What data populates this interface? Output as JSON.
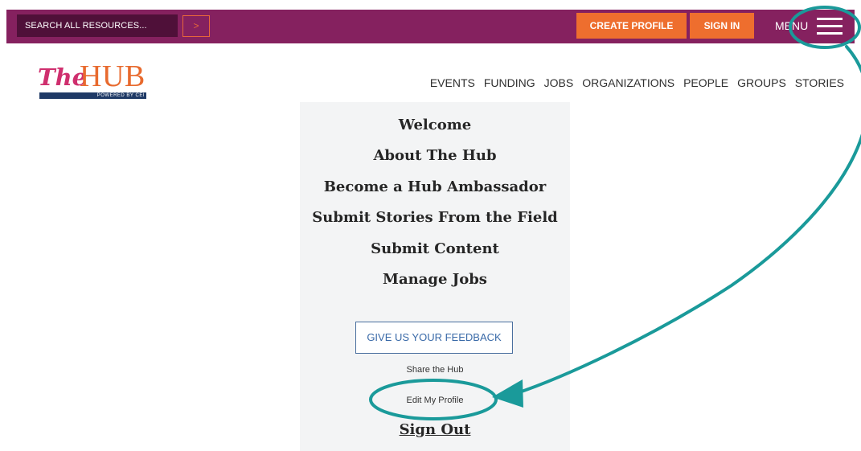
{
  "header": {
    "search_placeholder": "SEARCH ALL RESOURCES...",
    "search_button_glyph": ">",
    "create_profile": "CREATE PROFILE",
    "sign_in": "SIGN IN",
    "menu_label": "MENU"
  },
  "logo": {
    "the": "The",
    "hub": "HUB",
    "tagline": "POWERED BY CEI"
  },
  "nav": [
    "EVENTS",
    "FUNDING",
    "JOBS",
    "ORGANIZATIONS",
    "PEOPLE",
    "GROUPS",
    "STORIES"
  ],
  "dropdown": {
    "items": [
      "Welcome",
      "About The Hub",
      "Become a Hub Ambassador",
      "Submit Stories From the Field",
      "Submit Content",
      "Manage Jobs"
    ],
    "feedback_button": "GIVE US YOUR FEEDBACK",
    "share": "Share the Hub",
    "edit_profile": "Edit My Profile",
    "sign_out": "Sign Out"
  },
  "colors": {
    "header_bg": "#85215f",
    "search_bg": "#4f1039",
    "accent_orange": "#ee6e2e",
    "annotation_teal": "#1a9a9a",
    "dropdown_bg": "#f3f4f5"
  },
  "icons": {
    "menu": "hamburger-icon",
    "search_submit": "chevron-right-icon"
  }
}
